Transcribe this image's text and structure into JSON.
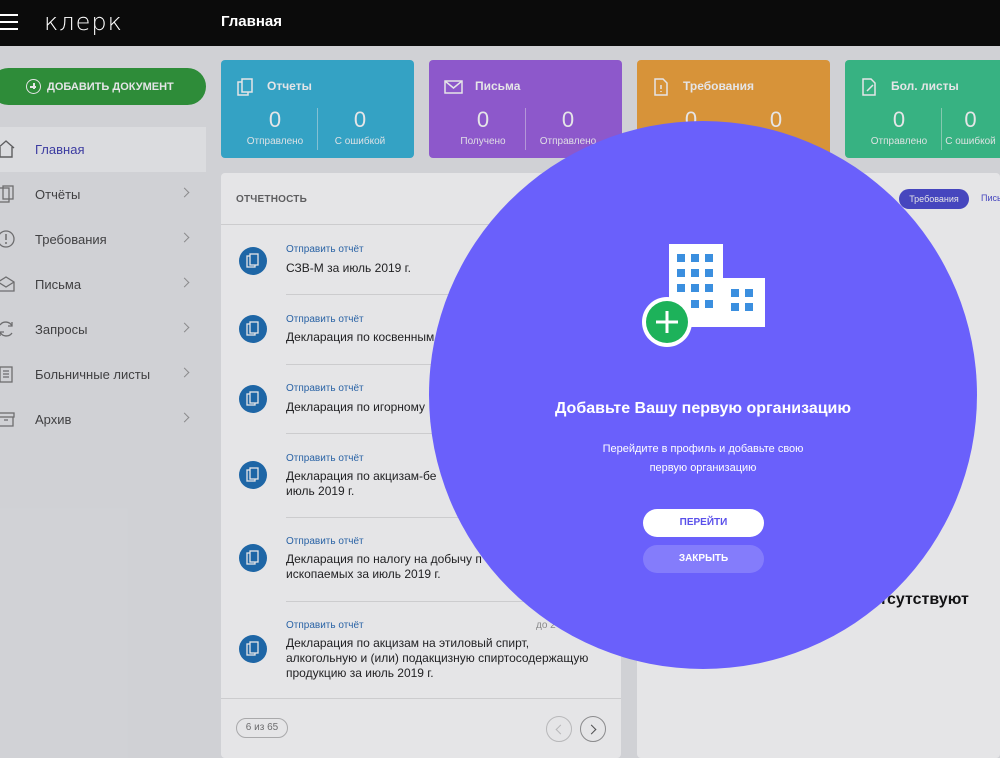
{
  "app": {
    "logo": "клерк",
    "page_title": "Главная"
  },
  "sidebar": {
    "add_document": "ДОБАВИТЬ ДОКУМЕНТ",
    "items": [
      {
        "label": "Главная",
        "icon": "home-icon"
      },
      {
        "label": "Отчёты",
        "icon": "reports-icon"
      },
      {
        "label": "Требования",
        "icon": "alert-icon"
      },
      {
        "label": "Письма",
        "icon": "envelope-icon"
      },
      {
        "label": "Запросы",
        "icon": "refresh-icon"
      },
      {
        "label": "Больничные листы",
        "icon": "clipboard-icon"
      },
      {
        "label": "Архив",
        "icon": "archive-icon"
      }
    ]
  },
  "cards": [
    {
      "title": "Отчеты",
      "color": "#36b3d8",
      "stats": [
        {
          "value": "0",
          "label": "Отправлено"
        },
        {
          "value": "0",
          "label": "С ошибкой"
        }
      ]
    },
    {
      "title": "Письма",
      "color": "#9b5fe0",
      "stats": [
        {
          "value": "0",
          "label": "Получено"
        },
        {
          "value": "0",
          "label": "Отправлено"
        }
      ]
    },
    {
      "title": "Требования",
      "color": "#f0a23a",
      "stats": [
        {
          "value": "0",
          "label": ""
        },
        {
          "value": "0",
          "label": ""
        }
      ]
    },
    {
      "title": "Бол. листы",
      "color": "#39c58c",
      "stats": [
        {
          "value": "0",
          "label": "Отправлено"
        },
        {
          "value": "0",
          "label": "С ошибкой"
        }
      ]
    }
  ],
  "reports": {
    "heading": "ОТЧЕТНОСТЬ",
    "items": [
      {
        "action": "Отправить отчёт",
        "title": "СЗВ-М за июль 2019 г.",
        "due": ""
      },
      {
        "action": "Отправить отчёт",
        "title": "Декларация по косвенным",
        "due": ""
      },
      {
        "action": "Отправить отчёт",
        "title": "Декларация по игорному",
        "due": ""
      },
      {
        "action": "Отправить отчёт",
        "title": "Декларация по акцизам-бе\nиюль 2019 г.",
        "due": ""
      },
      {
        "action": "Отправить отчёт",
        "title": "Декларация по налогу на добычу п\nископаемых за июль 2019 г.",
        "due": ""
      },
      {
        "action": "Отправить отчёт",
        "title": "Декларация по акцизам на этиловый спирт,\nалкогольную и (или) подакцизную спиртосодержащую\nпродукцию за июль 2019 г.",
        "due": "до 2"
      }
    ],
    "pager_text": "6 из 65"
  },
  "right_panel": {
    "active_chip": "Требования",
    "next_chip": "Пись",
    "empty_text": "отсутствуют"
  },
  "spotlight": {
    "title": "Добавьте Вашу первую организацию",
    "description_line1": "Перейдите в профиль и добавьте свою",
    "description_line2": "первую организацию",
    "go_button": "ПЕРЕЙТИ",
    "close_button": "ЗАКРЫТЬ"
  }
}
